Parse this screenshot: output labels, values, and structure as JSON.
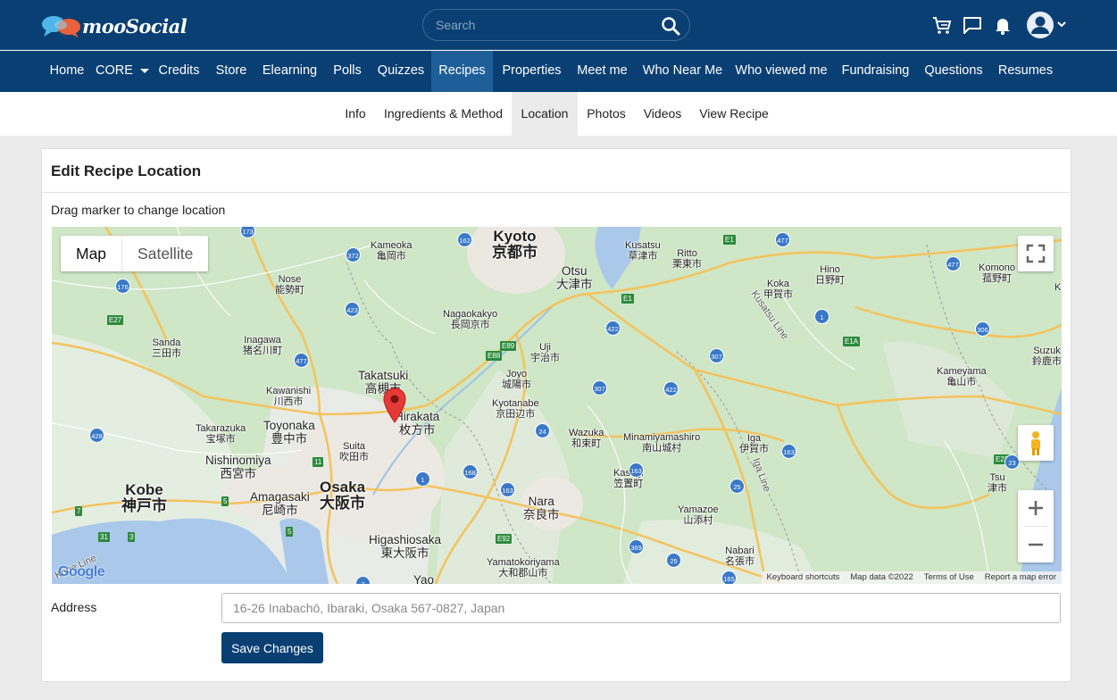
{
  "brand": {
    "name": "mooSocial"
  },
  "search": {
    "placeholder": "Search"
  },
  "nav": {
    "items": [
      {
        "label": "Home"
      },
      {
        "label": "CORE"
      },
      {
        "label": "Credits"
      },
      {
        "label": "Store"
      },
      {
        "label": "Elearning"
      },
      {
        "label": "Polls"
      },
      {
        "label": "Quizzes"
      },
      {
        "label": "Recipes"
      },
      {
        "label": "Properties"
      },
      {
        "label": "Meet me"
      },
      {
        "label": "Who Near Me"
      },
      {
        "label": "Who viewed me"
      },
      {
        "label": "Fundraising"
      },
      {
        "label": "Questions"
      },
      {
        "label": "Resumes"
      }
    ],
    "active": "Recipes"
  },
  "subtabs": {
    "items": [
      {
        "label": "Info"
      },
      {
        "label": "Ingredients & Method"
      },
      {
        "label": "Location"
      },
      {
        "label": "Photos"
      },
      {
        "label": "Videos"
      },
      {
        "label": "View Recipe"
      }
    ],
    "active": "Location"
  },
  "card": {
    "title": "Edit Recipe Location",
    "hint": "Drag marker to change location"
  },
  "map": {
    "type_map": "Map",
    "type_satellite": "Satellite",
    "google_text": "Google",
    "attribution": {
      "shortcuts": "Keyboard shortcuts",
      "data": "Map data ©2022",
      "terms": "Terms of Use",
      "report": "Report a map error"
    },
    "places": {
      "kyoto_en": "Kyoto",
      "kyoto_jp": "京都市",
      "otsu_en": "Otsu",
      "otsu_jp": "大津市",
      "kameoka_en": "Kameoka",
      "kameoka_jp": "亀岡市",
      "kusatsu_en": "Kusatsu",
      "kusatsu_jp": "草津市",
      "ritto_en": "Ritto",
      "ritto_jp": "栗東市",
      "hino_en": "Hino",
      "hino_jp": "日野町",
      "komono_en": "Komono",
      "komono_jp": "菰野町",
      "nose_en": "Nose",
      "nose_jp": "能勢町",
      "koka_en": "Koka",
      "koka_jp": "甲賀市",
      "nagaokakyo_en": "Nagaokakyo",
      "nagaokakyo_jp": "長岡京市",
      "sanda_en": "Sanda",
      "sanda_jp": "三田市",
      "inagawa_en": "Inagawa",
      "inagawa_jp": "猪名川町",
      "uji_en": "Uji",
      "uji_jp": "宇治市",
      "suzuka_en": "Suzuk",
      "suzuka_jp": "鈴鹿市",
      "kameyama_en": "Kameyama",
      "kameyama_jp": "亀山市",
      "takatsuki_en": "Takatsuki",
      "takatsuki_jp": "高槻市",
      "joyo_en": "Joyo",
      "joyo_jp": "城陽市",
      "kawanishi_en": "Kawanishi",
      "kawanishi_jp": "川西市",
      "hirakata_en": "Hirakata",
      "hirakata_jp": "枚方市",
      "kyotanabe_en": "Kyotanabe",
      "kyotanabe_jp": "京田辺市",
      "takarazuka_en": "Takarazuka",
      "takarazuka_jp": "宝塚市",
      "toyonaka_en": "Toyonaka",
      "toyonaka_jp": "豊中市",
      "wazuka_en": "Wazuka",
      "wazuka_jp": "和束町",
      "minamiyamashiro_en": "Minamiyamashiro",
      "minamiyamashiro_jp": "南山城村",
      "iga_en": "Iga",
      "iga_jp": "伊賀市",
      "suita_en": "Suita",
      "suita_jp": "吹田市",
      "nishinomiya_en": "Nishinomiya",
      "nishinomiya_jp": "西宮市",
      "kasagi_en": "Kasagi",
      "kasagi_jp": "笠置町",
      "tsu_en": "Tsu",
      "tsu_jp": "津市",
      "kobe_en": "Kobe",
      "kobe_jp": "神戸市",
      "amagasaki_en": "Amagasaki",
      "amagasaki_jp": "尼崎市",
      "osaka_en": "Osaka",
      "osaka_jp": "大阪市",
      "nara_en": "Nara",
      "nara_jp": "奈良市",
      "yamazoe_en": "Yamazoe",
      "yamazoe_jp": "山添村",
      "higashiosaka_en": "Higashiosaka",
      "higashiosaka_jp": "東大阪市",
      "nabari_en": "Nabari",
      "nabari_jp": "名張市",
      "yamatokoriyama_en": "Yamatokoriyama",
      "yamatokoriyama_jp": "大和郡山市",
      "yao_en": "Yao",
      "kusatsu_line": "Kusatsu Line",
      "iga_line": "Iga Line",
      "kobe_line": "Kobe Line",
      "r1_ja": "Ko"
    },
    "routes": {
      "r173": "173",
      "r372": "372",
      "r162": "162",
      "r477a": "477",
      "e1a": "E1",
      "e1b": "E1",
      "r477b": "477",
      "r176": "176",
      "e27": "E27",
      "r423": "423",
      "r477c": "477",
      "e89": "E89",
      "e88": "E88",
      "r422a": "422",
      "r1a": "1",
      "e1a2": "E1A",
      "r306": "306",
      "r307": "307",
      "r422b": "422",
      "r307b": "307",
      "r24": "24",
      "r163a": "163",
      "r168": "168",
      "r428": "428",
      "r11": "11",
      "r1b": "1",
      "r5a": "5",
      "r5b": "5",
      "r163b": "163",
      "r7": "7",
      "r31": "31",
      "r3": "3",
      "e92": "E92",
      "r25a": "25",
      "r25b": "25",
      "r369": "369",
      "r165": "165",
      "r163c": "163",
      "e23": "E23",
      "r23": "23",
      "r2": "2"
    }
  },
  "form": {
    "address_label": "Address",
    "address_placeholder": "16-26 Inabachō, Ibaraki, Osaka 567-0827, Japan",
    "address_value": "",
    "save_label": "Save Changes"
  }
}
